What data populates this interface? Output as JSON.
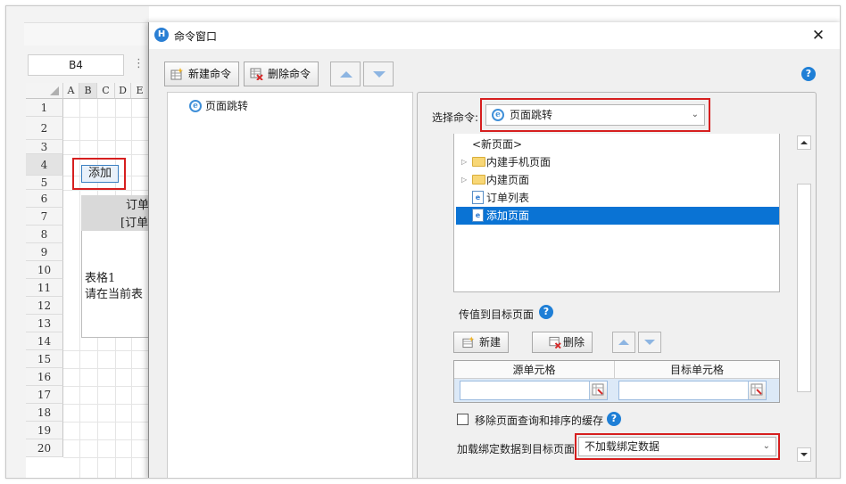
{
  "sheet": {
    "cell_ref": "B4",
    "columns": [
      "A",
      "B",
      "C",
      "D",
      "E"
    ],
    "rows": [
      "1",
      "2",
      "3",
      "4",
      "5",
      "6",
      "7",
      "8",
      "9",
      "10",
      "11",
      "12",
      "13",
      "14",
      "15",
      "16",
      "17",
      "18",
      "19",
      "20"
    ],
    "add_cell": "添加",
    "table_header": "订单",
    "table_bracket": "[订单",
    "table_name": "表格1",
    "table_hint": "请在当前表"
  },
  "dialog": {
    "title": "命令窗口",
    "close_glyph": "✕",
    "toolbar": {
      "new_command": "新建命令",
      "delete_command": "删除命令"
    },
    "help_glyph": "?",
    "commands": [
      {
        "label": "页面跳转",
        "icon": "ie-icon"
      }
    ],
    "detail": {
      "select_command_label": "选择命令:",
      "select_command_value": "页面跳转",
      "tree": [
        {
          "label": "<新页面>",
          "type": "item"
        },
        {
          "label": "内建手机页面",
          "type": "folder"
        },
        {
          "label": "内建页面",
          "type": "folder"
        },
        {
          "label": "订单列表",
          "type": "page"
        },
        {
          "label": "添加页面",
          "type": "page",
          "selected": true
        }
      ],
      "pass_value_label": "传值到目标页面",
      "new_label": "新建",
      "delete_label": "删除",
      "source_cell_header": "源单元格",
      "target_cell_header": "目标单元格",
      "clear_cache_label": "移除页面查询和排序的缓存",
      "load_bound_label": "加载绑定数据到目标页面",
      "load_bound_value": "不加载绑定数据"
    }
  },
  "colors": {
    "highlight_red": "#d61f1f",
    "selection_blue": "#0a73d4",
    "help_blue": "#1f7fd6"
  }
}
